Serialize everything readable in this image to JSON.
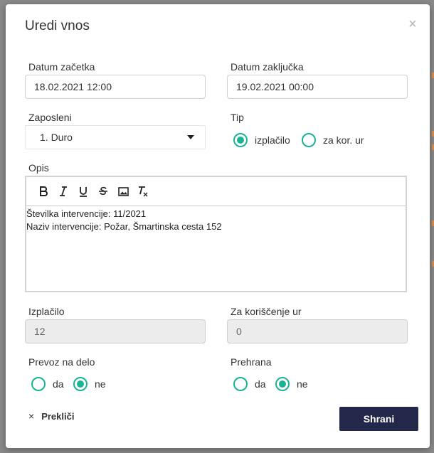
{
  "dialog": {
    "title": "Uredi vnos",
    "close_icon": "×"
  },
  "form": {
    "start_date": {
      "label": "Datum začetka",
      "value": "18.02.2021 12:00"
    },
    "end_date": {
      "label": "Datum zaključka",
      "value": "19.02.2021 00:00"
    },
    "employee": {
      "label": "Zaposleni",
      "value": "1. Duro"
    },
    "type": {
      "label": "Tip",
      "options": [
        {
          "label": "izplačilo",
          "selected": true
        },
        {
          "label": "za kor. ur",
          "selected": false
        }
      ]
    },
    "description": {
      "label": "Opis",
      "toolbar": [
        "bold-icon",
        "italic-icon",
        "underline-icon",
        "strikethrough-icon",
        "image-icon",
        "clear-format-icon"
      ],
      "lines": [
        "Številka intervencije: 11/2021",
        "Naziv intervencije: Požar, Šmartinska cesta 152"
      ]
    },
    "paid": {
      "label": "Izplačilo",
      "value": "12"
    },
    "hours_use": {
      "label": "Za koriščenje ur",
      "value": "0"
    },
    "transport": {
      "label": "Prevoz na delo",
      "options": [
        {
          "label": "da",
          "selected": false
        },
        {
          "label": "ne",
          "selected": true
        }
      ]
    },
    "meals": {
      "label": "Prehrana",
      "options": [
        {
          "label": "da",
          "selected": false
        },
        {
          "label": "ne",
          "selected": true
        }
      ]
    }
  },
  "footer": {
    "cancel_label": "Prekliči",
    "cancel_icon": "×",
    "save_label": "Shrani"
  },
  "colors": {
    "accent": "#1ab394",
    "primary_button": "#23284a"
  }
}
